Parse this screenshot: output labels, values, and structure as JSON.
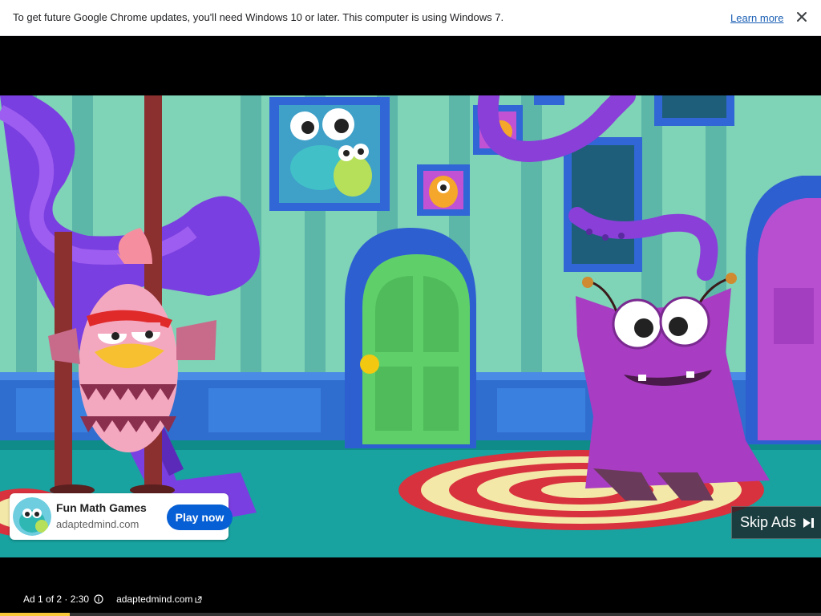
{
  "infobar": {
    "message": "To get future Google Chrome updates, you'll need Windows 10 or later. This computer is using Windows 7.",
    "learn_more": "Learn more",
    "close_icon": "close-icon"
  },
  "ad": {
    "title": "Fun Math Games",
    "domain": "adaptedmind.com",
    "cta": "Play now",
    "cta_color": "#065fd4"
  },
  "skip": {
    "label": "Skip Ads",
    "icon": "skip-next-icon"
  },
  "meta": {
    "counter": "Ad 1 of 2 · 2:30",
    "url": "adaptedmind.com",
    "progress": 0.085,
    "progress_color": "#f6c83a"
  }
}
